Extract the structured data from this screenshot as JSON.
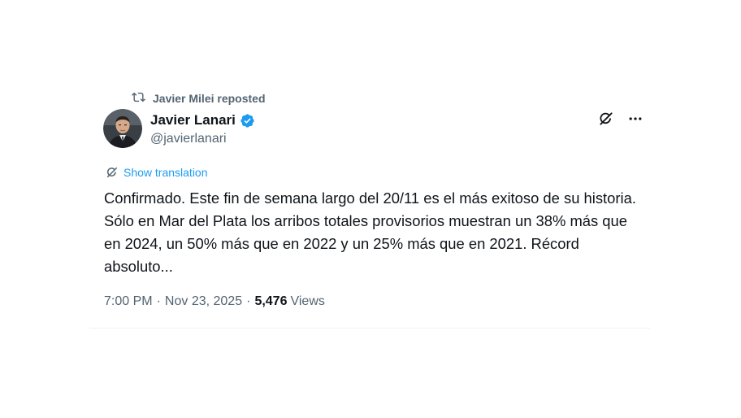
{
  "repost": {
    "icon": "repost-icon",
    "text": "Javier Milei reposted"
  },
  "author": {
    "display_name": "Javier Lanari",
    "handle": "@javierlanari",
    "verified": true,
    "verified_color": "#1d9bf0"
  },
  "actions": {
    "grok_icon": "grok-icon",
    "more_icon": "more-options-icon"
  },
  "translation": {
    "icon": "translate-icon",
    "label": "Show translation"
  },
  "tweet": {
    "text": "Confirmado. Este fin de semana largo del 20/11 es el más exitoso de su historia. Sólo en Mar del Plata los arribos totales provisorios muestran un 38% más que en 2024, un 50% más que en 2022 y un 25% más que en 2021. Récord absoluto..."
  },
  "meta": {
    "time": "7:00 PM",
    "date": "Nov 23, 2025",
    "separator": "·",
    "views_count": "5,476",
    "views_label": "Views"
  },
  "colors": {
    "text_primary": "#0f1419",
    "text_secondary": "#536471",
    "accent": "#1d9bf0"
  }
}
